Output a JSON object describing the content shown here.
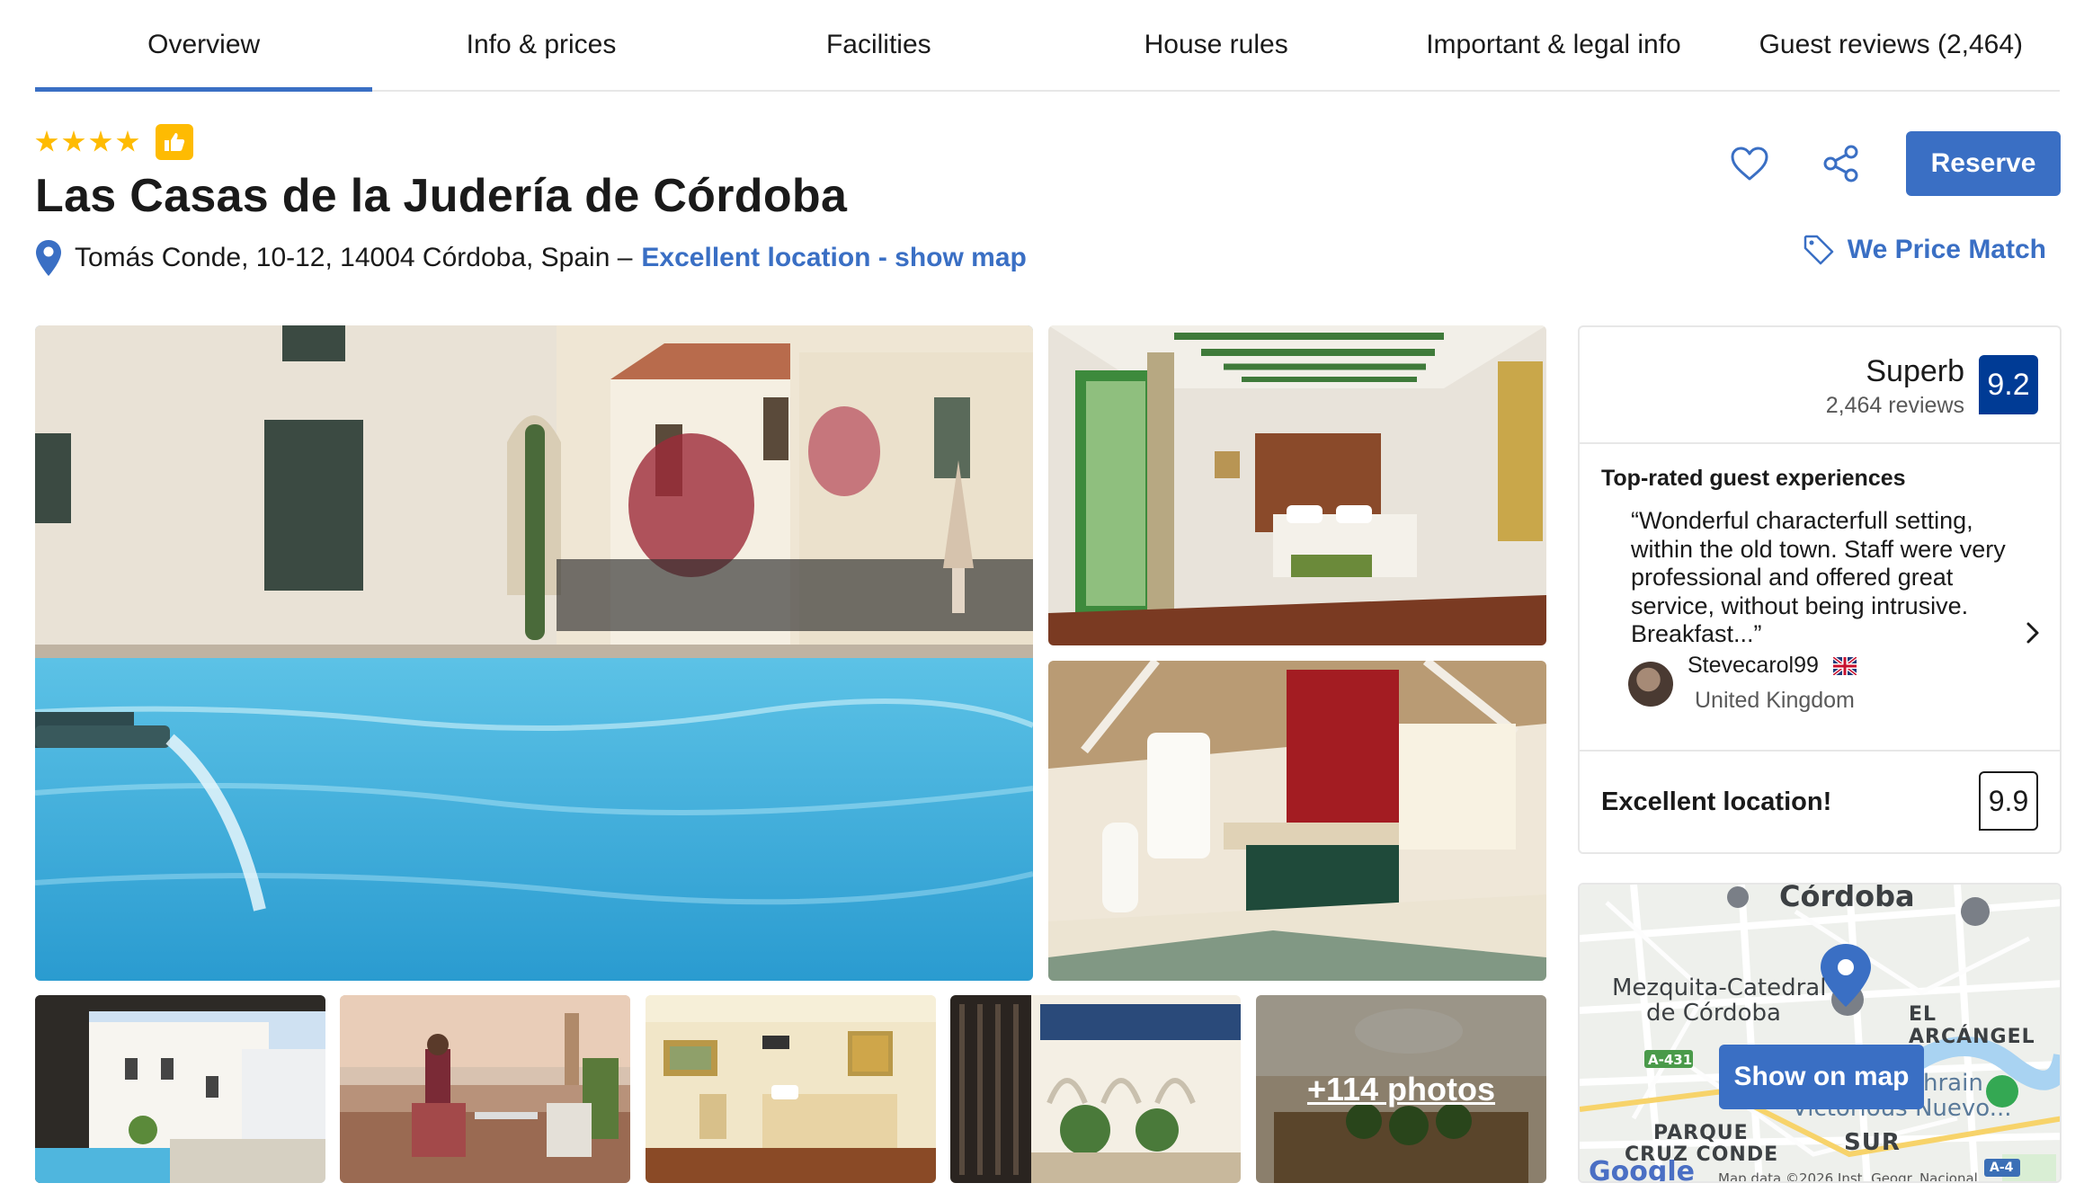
{
  "tabs": [
    {
      "label": "Overview",
      "active": true
    },
    {
      "label": "Info & prices"
    },
    {
      "label": "Facilities"
    },
    {
      "label": "House rules"
    },
    {
      "label": "Important & legal info"
    },
    {
      "label": "Guest reviews (2,464)"
    }
  ],
  "hotel": {
    "stars": 4,
    "name": "Las Casas de la Judería de Córdoba",
    "address": "Tomás Conde, 10-12, 14004 Córdoba, Spain –",
    "location_link": "Excellent location - show map"
  },
  "actions": {
    "reserve_label": "Reserve",
    "price_match_label": "We Price Match",
    "save_icon": "heart-icon",
    "share_icon": "share-icon"
  },
  "gallery": {
    "more_photos_label": "+114 photos"
  },
  "rating": {
    "word": "Superb",
    "reviews": "2,464 reviews",
    "score": "9.2"
  },
  "experiences": {
    "title": "Top-rated guest experiences",
    "quote": "“Wonderful characterfull setting, within the old town. Staff were very professional and offered great service, without being intrusive. Breakfast...”",
    "reviewer_name": "Stevecarol99",
    "reviewer_country": "United Kingdom"
  },
  "location": {
    "label": "Excellent location!",
    "score": "9.9"
  },
  "map": {
    "button_label": "Show on map",
    "city_label": "Córdoba",
    "poi_label_1": "Mezquita-Catedral",
    "poi_label_2": "de Córdoba",
    "district_1": "EL ARCÁNGEL",
    "district_2": "PARQUE",
    "district_3": "CRUZ CONDE",
    "district_4": "SUR",
    "road_1": "A-431",
    "road_2": "A-4",
    "poi_label_3": "hrain",
    "poi_label_4": "Victorious Nuevo...",
    "attribution": "Map data ©2026 Inst. Geogr. Nacional",
    "google": "Google"
  },
  "colors": {
    "accent": "#3a6fc4",
    "score_bg": "#003b95",
    "star": "#febb02"
  }
}
